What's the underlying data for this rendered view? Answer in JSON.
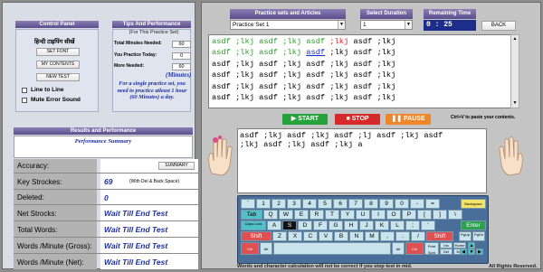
{
  "control_panel": {
    "title": "Control Panel",
    "hindi_text": "हिन्दी टाइपिंग सीखें",
    "set_font": "SET FONT",
    "my_contents": "MY CONTENTS",
    "new_test": "NEW TEST",
    "line_to_line": "Line to Line",
    "mute_error_sound": "Mute Error Sound"
  },
  "tips": {
    "title": "Tips And Performance",
    "subtitle": "(For This Practice Set)",
    "total_label": "Total Minutes Needed:",
    "total_value": "60",
    "today_label": "You Practice Today:",
    "today_value": "0",
    "more_label": "More Needed:",
    "more_value": "60",
    "minutes_label": "(Minutes)",
    "note": "For a single practice set, you need to practice atleast 1 hour (60 Minutes) a day."
  },
  "results": {
    "title": "Results and Performance",
    "summary_title": "Performance Summary",
    "accuracy_label": "Accuracy:",
    "summary_button": "SUMMARY",
    "keystrokes_label": "Key Strockes:",
    "keystrokes_value": "69",
    "keystrokes_note": "(With Del & Back Space)",
    "deleted_label": "Deleted:",
    "deleted_value": "0",
    "net_label": "Net Strocks:",
    "net_value": "Wait Till End Test",
    "total_words_label": "Total Words:",
    "total_words_value": "Wait Till End Test",
    "wpm_gross_label": "Words /Minute (Gross):",
    "wpm_gross_value": "Wait Till End Test",
    "wpm_net_label": "Words /Minute (Net):",
    "wpm_net_value": "Wait Till End Test"
  },
  "toolbar": {
    "practice_sets_label": "Practice sets and Articles",
    "practice_set_value": "Practice Set 1",
    "duration_label": "Select Duration",
    "duration_value": "1",
    "remaining_label": "Remaining Time",
    "remaining_value": "0 : 25",
    "back_label": "BACK"
  },
  "practice_text": {
    "lines": [
      "asdf ;lkj asdf ;lkj asdf ;lkj asdf ;lkj",
      "asdf ;lkj asdf ;lkj asdf ;lkj asdf ;lkj",
      "asdf ;lkj asdf ;lkj asdf ;lkj asdf ;lkj",
      "asdf ;lkj asdf ;lkj asdf ;lkj asdf ;lkj",
      "asdf ;lkj asdf ;lkj asdf ;lkj asdf ;lkj",
      "asdf ;lkj asdf ;lkj asdf ;lkj asdf ;lkj"
    ]
  },
  "controls": {
    "start": "START",
    "stop": "STOP",
    "pause": "PAUSE",
    "paste_hint": "Ctrl+V to paste your contents."
  },
  "typed": {
    "lines": [
      "asdf ;lkj asdf ;lkj asdf ;lj asdf ;lkj asdf",
      ";lkj asdf ;lkj asdf ;lkj a"
    ]
  },
  "keyboard": {
    "row_numbers": [
      "`",
      "1",
      "2",
      "3",
      "4",
      "5",
      "6",
      "7",
      "8",
      "9",
      "0",
      "-",
      "="
    ],
    "backspace": "Backspace",
    "tab": "Tab",
    "row_q": [
      "Q",
      "W",
      "E",
      "R",
      "T",
      "Y",
      "U",
      "I",
      "O",
      "P",
      "[",
      "]",
      "\\"
    ],
    "caps": "Caps Lock",
    "row_a": [
      "A",
      "S",
      "D",
      "F",
      "G",
      "H",
      "J",
      "K",
      "L",
      ";",
      "'"
    ],
    "enter": "Enter",
    "shift": "Shift",
    "row_z": [
      "Z",
      "X",
      "C",
      "V",
      "B",
      "N",
      "M",
      ",",
      ".",
      "/"
    ],
    "shift_r": "Shift",
    "pgup": "PgUp",
    "pgdn": "PgDn",
    "home": "Home",
    "end": "End",
    "ctrl": "Ctrl",
    "ctrl_r": "Ctrl",
    "alt": "Alt",
    "alt_r": "Alt",
    "print_scr": "Print Scrn",
    "ins": "Ins",
    "del": "Del"
  },
  "footer": {
    "warning": "Words and character calculation will not be correct if you stop test in mid.",
    "rights": "All Rights Reserved."
  }
}
